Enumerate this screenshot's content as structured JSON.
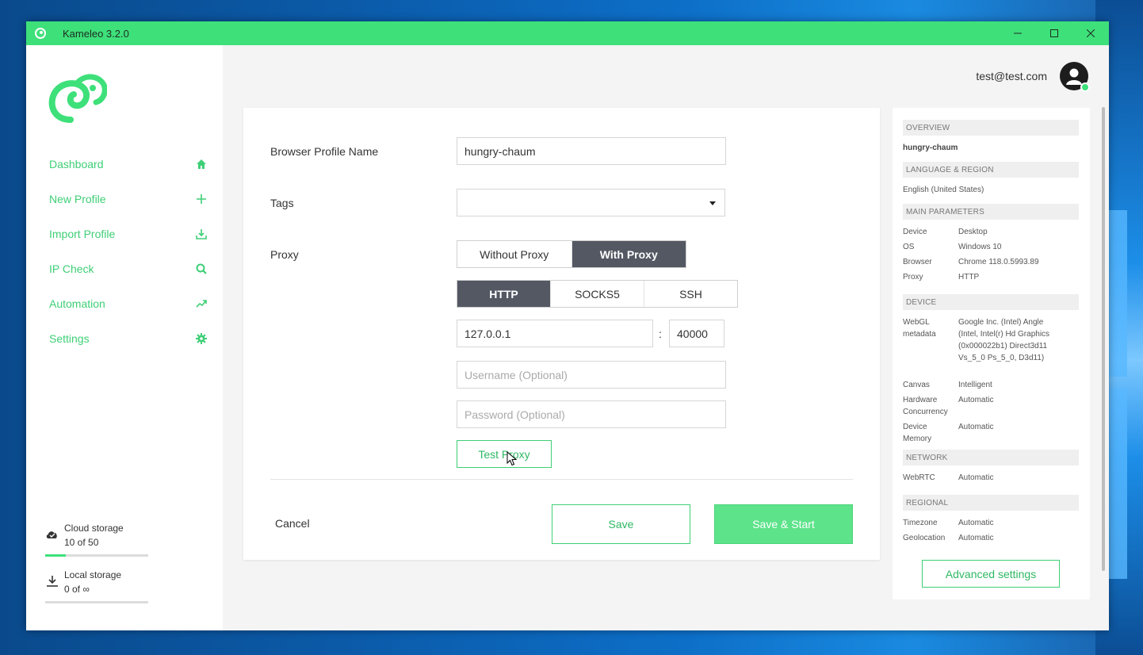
{
  "window": {
    "title": "Kameleo 3.2.0",
    "controls": [
      "minimize-icon",
      "maximize-icon",
      "close-icon"
    ]
  },
  "sidebar": {
    "items": [
      {
        "label": "Dashboard",
        "icon": "home-icon"
      },
      {
        "label": "New Profile",
        "icon": "plus-icon"
      },
      {
        "label": "Import Profile",
        "icon": "import-icon"
      },
      {
        "label": "IP Check",
        "icon": "search-icon"
      },
      {
        "label": "Automation",
        "icon": "trend-icon"
      },
      {
        "label": "Settings",
        "icon": "gear-icon"
      }
    ],
    "cloud_storage": {
      "label": "Cloud storage",
      "value": "10 of 50",
      "fraction": 0.2
    },
    "local_storage": {
      "label": "Local storage",
      "value": "0 of ∞",
      "fraction": 0
    }
  },
  "header": {
    "email": "test@test.com"
  },
  "form": {
    "profile_name_label": "Browser Profile Name",
    "profile_name_value": "hungry-chaum",
    "tags_label": "Tags",
    "proxy_label": "Proxy",
    "proxy_mode": {
      "options": [
        "Without Proxy",
        "With Proxy"
      ],
      "selected": "With Proxy"
    },
    "proxy_type": {
      "options": [
        "HTTP",
        "SOCKS5",
        "SSH"
      ],
      "selected": "HTTP"
    },
    "host": "127.0.0.1",
    "colon": ":",
    "port": "40000",
    "username_placeholder": "Username (Optional)",
    "password_placeholder": "Password (Optional)",
    "test_proxy_label": "Test Proxy",
    "cancel_label": "Cancel",
    "save_label": "Save",
    "save_start_label": "Save & Start"
  },
  "overview": {
    "overview_header": "OVERVIEW",
    "profile_name": "hungry-chaum",
    "language_header": "LANGUAGE & REGION",
    "language": "English (United States)",
    "main_header": "MAIN PARAMETERS",
    "main": [
      {
        "key": "Device",
        "value": "Desktop"
      },
      {
        "key": "OS",
        "value": "Windows 10"
      },
      {
        "key": "Browser",
        "value": "Chrome 118.0.5993.89"
      },
      {
        "key": "Proxy",
        "value": "HTTP"
      }
    ],
    "device_header": "DEVICE",
    "device": [
      {
        "key": "WebGL metadata",
        "value": "Google Inc. (Intel) Angle (Intel, Intel(r) Hd Graphics (0x000022b1) Direct3d11 Vs_5_0 Ps_5_0, D3d11)"
      },
      {
        "key": "Canvas",
        "value": "Intelligent"
      },
      {
        "key": "Hardware Concurrency",
        "value": "Automatic"
      },
      {
        "key": "Device Memory",
        "value": "Automatic"
      }
    ],
    "network_header": "NETWORK",
    "network": [
      {
        "key": "WebRTC",
        "value": "Automatic"
      }
    ],
    "regional_header": "REGIONAL",
    "regional": [
      {
        "key": "Timezone",
        "value": "Automatic"
      },
      {
        "key": "Geolocation",
        "value": "Automatic"
      }
    ],
    "advanced_label": "Advanced settings"
  },
  "colors": {
    "accent": "#3ee07a",
    "accent_text": "#3ecf76",
    "dark_segment": "#535863"
  }
}
